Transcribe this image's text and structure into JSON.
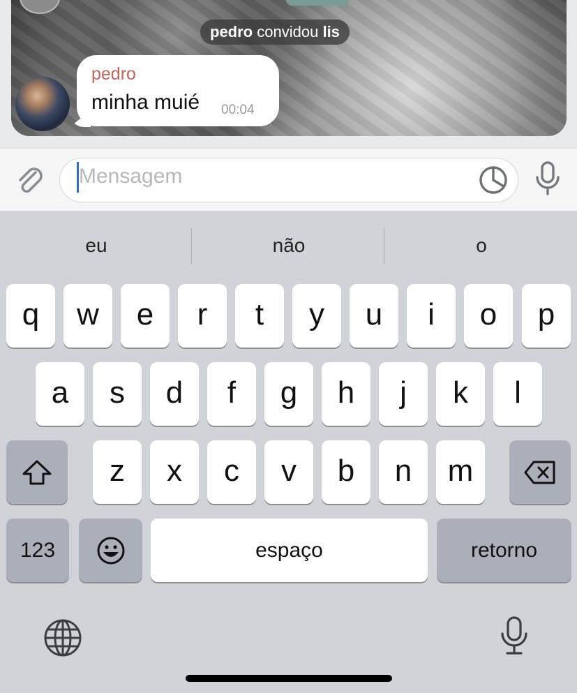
{
  "chat": {
    "service_message": {
      "actor": "pedro",
      "verb": "convidou",
      "target": "lis"
    },
    "message": {
      "sender": "pedro",
      "text": "minha muié",
      "time": "00:04"
    }
  },
  "input": {
    "placeholder": "Mensagem"
  },
  "suggestions": [
    "eu",
    "não",
    "o"
  ],
  "keyboard": {
    "row1": [
      "q",
      "w",
      "e",
      "r",
      "t",
      "y",
      "u",
      "i",
      "o",
      "p"
    ],
    "row2": [
      "a",
      "s",
      "d",
      "f",
      "g",
      "h",
      "j",
      "k",
      "l"
    ],
    "row3": [
      "z",
      "x",
      "c",
      "v",
      "b",
      "n",
      "m"
    ],
    "numbers_label": "123",
    "space_label": "espaço",
    "return_label": "retorno"
  },
  "colors": {
    "sender_name": "#c2675a",
    "cursor": "#2f6fce",
    "keyboard_bg": "#d2d3d9"
  }
}
